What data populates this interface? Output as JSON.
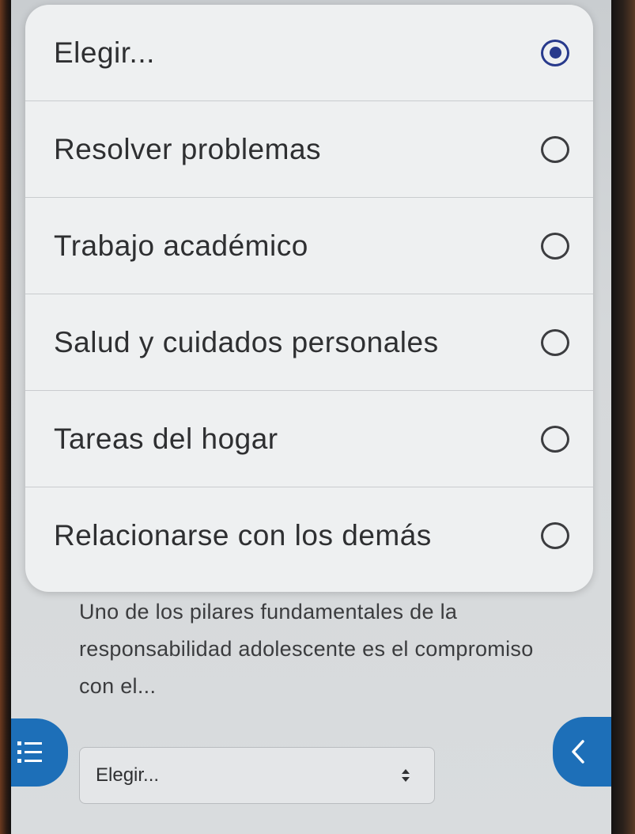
{
  "dropdown": {
    "options": [
      {
        "label": "Elegir...",
        "selected": true
      },
      {
        "label": "Resolver problemas",
        "selected": false
      },
      {
        "label": "Trabajo académico",
        "selected": false
      },
      {
        "label": "Salud y cuidados personales",
        "selected": false
      },
      {
        "label": "Tareas del hogar",
        "selected": false
      },
      {
        "label": "Relacionarse con los demás",
        "selected": false
      }
    ]
  },
  "question": {
    "text": "Uno de los pilares fundamentales de la responsabilidad adolescente es el compromiso con el..."
  },
  "answer_select": {
    "value": "Elegir..."
  },
  "icons": {
    "left_tab": "list-icon",
    "right_tab": "chevron-left-icon"
  },
  "colors": {
    "accent": "#1d6fb8",
    "radio_checked": "#283a8c"
  }
}
